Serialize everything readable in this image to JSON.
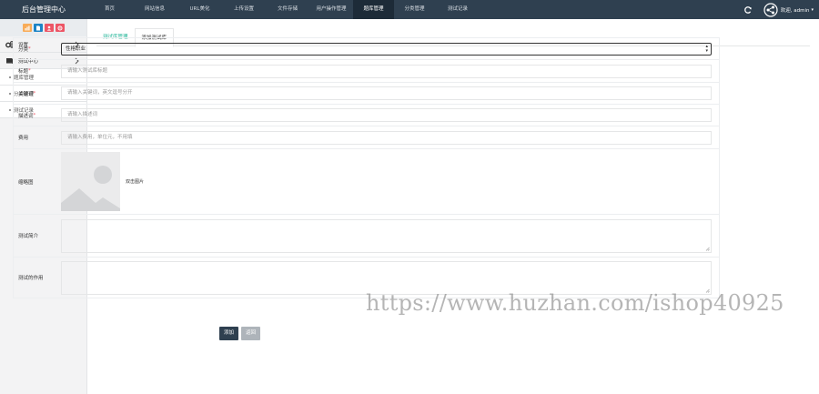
{
  "brand": "后台管理中心",
  "nav": [
    {
      "label": "首页",
      "active": false
    },
    {
      "label": "网站信息",
      "active": false
    },
    {
      "label": "URL美化",
      "active": false
    },
    {
      "label": "上传设置",
      "active": false
    },
    {
      "label": "文件存储",
      "active": false
    },
    {
      "label": "用户操作管理",
      "active": false
    },
    {
      "label": "题库管理",
      "active": true
    },
    {
      "label": "分类管理",
      "active": false
    },
    {
      "label": "测试记录",
      "active": false
    }
  ],
  "user": {
    "greeting": "欢迎, admin",
    "caret": "▾"
  },
  "sidebar": {
    "quick_colors": [
      "#f8ac59",
      "#1c84c6",
      "#ed5565",
      "#ed5565"
    ],
    "sections": [
      {
        "label": "设置",
        "icon": "gears-icon"
      },
      {
        "label": "测试中心",
        "icon": "book-icon"
      }
    ],
    "sub_items": [
      {
        "label": "题库管理"
      },
      {
        "label": "分类管理"
      },
      {
        "label": "测试记录"
      }
    ]
  },
  "tabs": [
    {
      "label": "测试库管理",
      "active": false
    },
    {
      "label": "添加测试库",
      "active": true
    }
  ],
  "form": {
    "category": {
      "label": "分类",
      "required": "*",
      "value": "性格职业"
    },
    "title": {
      "label": "标题",
      "required": "*",
      "placeholder": "请输入测试库标题"
    },
    "keywords": {
      "label": "关键词",
      "required": "*",
      "placeholder": "请输入关键词，英文逗号分开"
    },
    "description": {
      "label": "描述词",
      "required": "*",
      "placeholder": "请输入描述词"
    },
    "fee": {
      "label": "费用",
      "placeholder": "请输入费用，单位元，不用填"
    },
    "thumbnail": {
      "label": "缩略图",
      "pick_text": "双击图片"
    },
    "intro": {
      "label": "测试简介"
    },
    "purpose": {
      "label": "测试的作用"
    }
  },
  "buttons": {
    "submit": "添加",
    "back": "返回"
  },
  "watermark": "https://www.huzhan.com/ishop40925"
}
